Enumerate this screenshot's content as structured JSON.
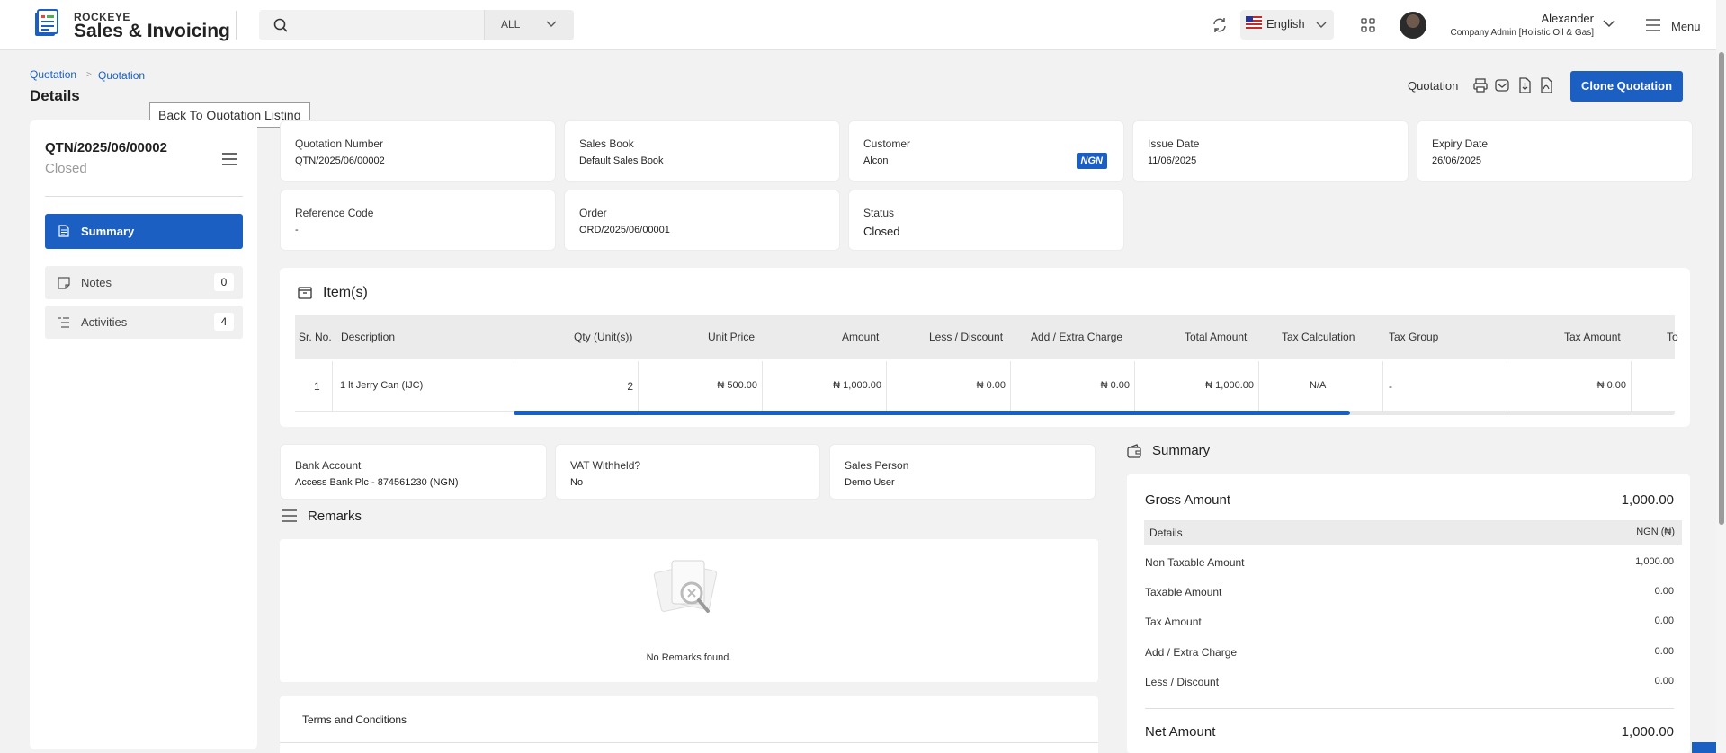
{
  "header": {
    "brand_small": "ROCKEYE",
    "brand_big": "Sales & Invoicing",
    "search_scope": "ALL",
    "language": "English",
    "user_name": "Alexander",
    "user_role": "Company Admin [Holistic Oil & Gas]",
    "menu_label": "Menu"
  },
  "breadcrumb": [
    "Quotation",
    "Quotation"
  ],
  "page_title": "Details",
  "tooltip": "Back To Quotation Listing",
  "toolbar": {
    "label": "Quotation",
    "clone_label": "Clone Quotation"
  },
  "left": {
    "quotation_no": "QTN/2025/06/00002",
    "status": "Closed",
    "nav": [
      {
        "label": "Summary"
      },
      {
        "label": "Notes",
        "count": "0"
      },
      {
        "label": "Activities",
        "count": "4"
      }
    ]
  },
  "fields": {
    "quotation_number": {
      "label": "Quotation Number",
      "value": "QTN/2025/06/00002"
    },
    "sales_book": {
      "label": "Sales Book",
      "value": "Default Sales Book"
    },
    "customer": {
      "label": "Customer",
      "value": "Alcon",
      "currency": "NGN"
    },
    "issue_date": {
      "label": "Issue Date",
      "value": "11/06/2025"
    },
    "expiry_date": {
      "label": "Expiry Date",
      "value": "26/06/2025"
    },
    "reference_code": {
      "label": "Reference Code",
      "value": "-"
    },
    "order": {
      "label": "Order",
      "value": "ORD/2025/06/00001"
    },
    "status": {
      "label": "Status",
      "value": "Closed"
    }
  },
  "items": {
    "title": "Item(s)",
    "columns": [
      "Sr. No.",
      "Description",
      "Qty (Unit(s))",
      "Unit Price",
      "Amount",
      "Less / Discount",
      "Add / Extra Charge",
      "Total Amount",
      "Tax Calculation",
      "Tax Group",
      "Tax Amount",
      "To"
    ],
    "rows": [
      [
        "1",
        "1 lt Jerry Can (IJC)",
        "2",
        "₦ 500.00",
        "₦ 1,000.00",
        "₦ 0.00",
        "₦ 0.00",
        "₦ 1,000.00",
        "N/A",
        "-",
        "₦ 0.00",
        ""
      ]
    ],
    "scroll_fraction": 0.72
  },
  "extra": {
    "bank_account": {
      "label": "Bank Account",
      "value": "Access Bank Plc - 874561230 (NGN)"
    },
    "vat_withheld": {
      "label": "VAT Withheld?",
      "value": "No"
    },
    "sales_person": {
      "label": "Sales Person",
      "value": "Demo User"
    }
  },
  "remarks": {
    "title": "Remarks",
    "empty": "No Remarks found."
  },
  "terms": {
    "title": "Terms and Conditions"
  },
  "summary": {
    "title": "Summary",
    "gross_label": "Gross Amount",
    "gross_value": "1,000.00",
    "details_label": "Details",
    "details_value": "NGN (₦)",
    "rows": [
      {
        "label": "Non Taxable Amount",
        "value": "1,000.00"
      },
      {
        "label": "Taxable Amount",
        "value": "0.00"
      },
      {
        "label": "Tax Amount",
        "value": "0.00"
      },
      {
        "label": "Add / Extra Charge",
        "value": "0.00"
      },
      {
        "label": "Less / Discount",
        "value": "0.00"
      }
    ],
    "net_label": "Net Amount",
    "net_value": "1,000.00"
  },
  "colors": {
    "accent": "#1a5fc1",
    "background": "#f2f2f2"
  }
}
